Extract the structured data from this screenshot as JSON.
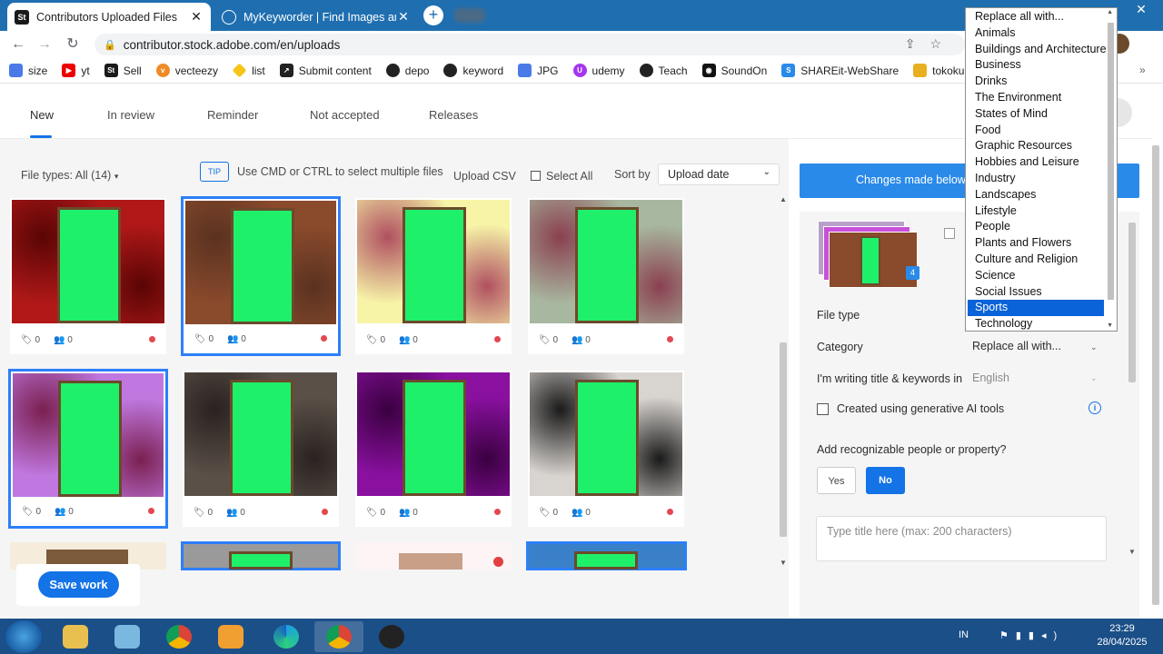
{
  "browser": {
    "tabs": [
      {
        "title": "Contributors Uploaded Files",
        "favicon": "St",
        "active": true
      },
      {
        "title": "MyKeyworder | Find Images and",
        "favicon": "globe-icon",
        "active": false
      }
    ],
    "new_tab": "+",
    "url": "contributor.stock.adobe.com/en/uploads",
    "bookmarks": [
      "size",
      "yt",
      "Sell",
      "vecteezy",
      "list",
      "Submit content",
      "depo",
      "keyword",
      "JPG",
      "udemy",
      "Teach",
      "SoundOn",
      "SHAREit-WebShare",
      "tokoku"
    ],
    "window_controls": {
      "minimize": "—",
      "close": "✕"
    }
  },
  "nav": {
    "tabs": [
      "New",
      "In review",
      "Reminder",
      "Not accepted",
      "Releases"
    ],
    "active": "New"
  },
  "filters": {
    "file_types": "File types: All (14)",
    "tip_badge": "TIP",
    "tip_text": "Use CMD or CTRL to select multiple files",
    "upload_csv": "Upload CSV",
    "select_all": "Select All",
    "sort_label": "Sort by",
    "sort_value": "Upload date"
  },
  "thumbnails": [
    {
      "keywords": "0",
      "people": "0",
      "selected": false,
      "bg": "#b01818",
      "accent": "#5a0505",
      "dot": true
    },
    {
      "keywords": "0",
      "people": "0",
      "selected": true,
      "bg": "#8a4a2c",
      "accent": "#5a3220",
      "dot": true
    },
    {
      "keywords": "0",
      "people": "0",
      "selected": false,
      "bg": "#f7f4a8",
      "accent": "#b05060",
      "dot": true
    },
    {
      "keywords": "0",
      "people": "0",
      "selected": false,
      "bg": "#a8b8a0",
      "accent": "#8a4050",
      "dot": true
    },
    {
      "keywords": "0",
      "people": "0",
      "selected": true,
      "bg": "#c078e0",
      "accent": "#7a2050",
      "dot": true
    },
    {
      "keywords": "0",
      "people": "0",
      "selected": false,
      "bg": "#5a5048",
      "accent": "#2a2220",
      "dot": true
    },
    {
      "keywords": "0",
      "people": "0",
      "selected": false,
      "bg": "#8a10a0",
      "accent": "#3a0040",
      "dot": true
    },
    {
      "keywords": "0",
      "people": "0",
      "selected": false,
      "bg": "#d8d4d0",
      "accent": "#1a1a1a",
      "dot": true
    }
  ],
  "save_work": "Save work",
  "right_panel": {
    "banner": "Changes made below w",
    "stack_count": "4",
    "file_type_label": "File type",
    "category_label": "Category",
    "category_value": "Replace all with...",
    "language_label": "I'm writing title & keywords in",
    "language_value": "English",
    "ai_label": "Created using generative AI tools",
    "info_icon": "i",
    "people_question": "Add recognizable people or property?",
    "yes": "Yes",
    "no": "No",
    "title_placeholder": "Type title here (max: 200 characters)"
  },
  "dropdown": {
    "options": [
      "Replace all with...",
      "Animals",
      "Buildings and Architecture",
      "Business",
      "Drinks",
      "The Environment",
      "States of Mind",
      "Food",
      "Graphic Resources",
      "Hobbies and Leisure",
      "Industry",
      "Landscapes",
      "Lifestyle",
      "People",
      "Plants and Flowers",
      "Culture and Religion",
      "Science",
      "Social Issues",
      "Sports",
      "Technology"
    ],
    "highlighted": "Sports"
  },
  "taskbar": {
    "lang": "IN",
    "time": "23:29",
    "date": "28/04/2025"
  },
  "colors": {
    "accent": "#1473e6",
    "chrome_tabbar": "#1f6fb0",
    "taskbar": "#1b4f88",
    "green_screen": "#1ff06a"
  }
}
